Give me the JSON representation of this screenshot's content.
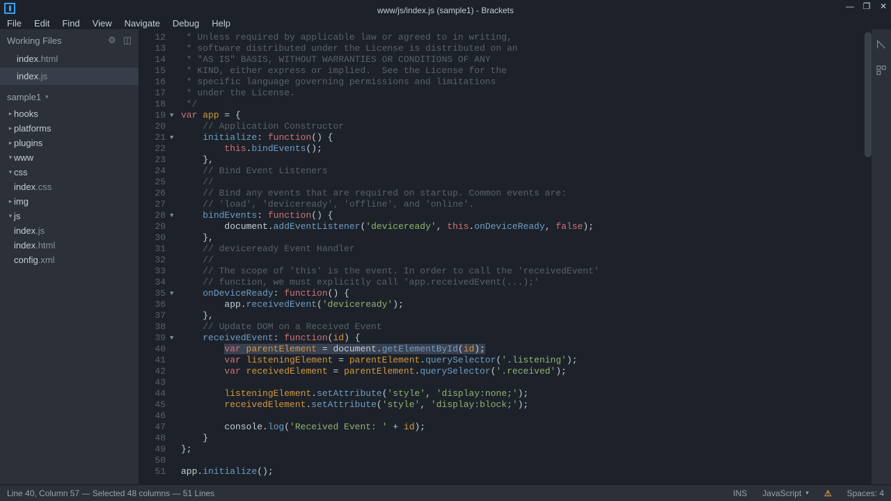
{
  "titlebar": {
    "title": "www/js/index.js (sample1) - Brackets"
  },
  "menu": [
    "File",
    "Edit",
    "Find",
    "View",
    "Navigate",
    "Debug",
    "Help"
  ],
  "workingFiles": {
    "label": "Working Files",
    "items": [
      {
        "name": "index",
        "ext": ".html",
        "active": false
      },
      {
        "name": "index",
        "ext": ".js",
        "active": true
      }
    ]
  },
  "project": {
    "name": "sample1",
    "tree": [
      {
        "depth": 1,
        "caret": "▸",
        "name": "hooks"
      },
      {
        "depth": 1,
        "caret": "▸",
        "name": "platforms"
      },
      {
        "depth": 1,
        "caret": "▸",
        "name": "plugins"
      },
      {
        "depth": 1,
        "caret": "▾",
        "name": "www"
      },
      {
        "depth": 2,
        "caret": "▾",
        "name": "css"
      },
      {
        "depth": 3,
        "caret": "",
        "name": "index",
        "ext": ".css"
      },
      {
        "depth": 2,
        "caret": "▸",
        "name": "img"
      },
      {
        "depth": 2,
        "caret": "▾",
        "name": "js"
      },
      {
        "depth": 3,
        "caret": "",
        "name": "index",
        "ext": ".js"
      },
      {
        "depth": 2,
        "caret": "",
        "name": "index",
        "ext": ".html"
      },
      {
        "depth": 1,
        "caret": "",
        "name": "config",
        "ext": ".xml"
      }
    ]
  },
  "code": {
    "startLine": 12,
    "folds": {
      "19": "▼",
      "21": "▼",
      "28": "▼",
      "35": "▼",
      "39": "▼"
    },
    "lines": [
      [
        {
          "t": " * Unless required by applicable law or agreed to in writing,",
          "c": "cmt"
        }
      ],
      [
        {
          "t": " * software distributed under the License is distributed on an",
          "c": "cmt"
        }
      ],
      [
        {
          "t": " * \"AS IS\" BASIS, WITHOUT WARRANTIES OR CONDITIONS OF ANY",
          "c": "cmt"
        }
      ],
      [
        {
          "t": " * KIND, either express or implied.  See the License for the",
          "c": "cmt"
        }
      ],
      [
        {
          "t": " * specific language governing permissions and limitations",
          "c": "cmt"
        }
      ],
      [
        {
          "t": " * under the License.",
          "c": "cmt"
        }
      ],
      [
        {
          "t": " */",
          "c": "cmt"
        }
      ],
      [
        {
          "t": "var ",
          "c": "key"
        },
        {
          "t": "app",
          "c": "var"
        },
        {
          "t": " = {",
          "c": "punc"
        }
      ],
      [
        {
          "t": "    ",
          "c": "punc"
        },
        {
          "t": "// Application Constructor",
          "c": "cmt"
        }
      ],
      [
        {
          "t": "    ",
          "c": "punc"
        },
        {
          "t": "initialize",
          "c": "prop"
        },
        {
          "t": ": ",
          "c": "punc"
        },
        {
          "t": "function",
          "c": "func"
        },
        {
          "t": "() {",
          "c": "punc"
        }
      ],
      [
        {
          "t": "        ",
          "c": "punc"
        },
        {
          "t": "this",
          "c": "key"
        },
        {
          "t": ".",
          "c": "punc"
        },
        {
          "t": "bindEvents",
          "c": "prop"
        },
        {
          "t": "();",
          "c": "punc"
        }
      ],
      [
        {
          "t": "    },",
          "c": "punc"
        }
      ],
      [
        {
          "t": "    ",
          "c": "punc"
        },
        {
          "t": "// Bind Event Listeners",
          "c": "cmt"
        }
      ],
      [
        {
          "t": "    ",
          "c": "punc"
        },
        {
          "t": "//",
          "c": "cmt"
        }
      ],
      [
        {
          "t": "    ",
          "c": "punc"
        },
        {
          "t": "// Bind any events that are required on startup. Common events are:",
          "c": "cmt"
        }
      ],
      [
        {
          "t": "    ",
          "c": "punc"
        },
        {
          "t": "// 'load', 'deviceready', 'offline', and 'online'.",
          "c": "cmt"
        }
      ],
      [
        {
          "t": "    ",
          "c": "punc"
        },
        {
          "t": "bindEvents",
          "c": "prop"
        },
        {
          "t": ": ",
          "c": "punc"
        },
        {
          "t": "function",
          "c": "func"
        },
        {
          "t": "() {",
          "c": "punc"
        }
      ],
      [
        {
          "t": "        document.",
          "c": "punc"
        },
        {
          "t": "addEventListener",
          "c": "prop"
        },
        {
          "t": "(",
          "c": "punc"
        },
        {
          "t": "'deviceready'",
          "c": "str"
        },
        {
          "t": ", ",
          "c": "punc"
        },
        {
          "t": "this",
          "c": "key"
        },
        {
          "t": ".",
          "c": "punc"
        },
        {
          "t": "onDeviceReady",
          "c": "prop"
        },
        {
          "t": ", ",
          "c": "punc"
        },
        {
          "t": "false",
          "c": "key"
        },
        {
          "t": ");",
          "c": "punc"
        }
      ],
      [
        {
          "t": "    },",
          "c": "punc"
        }
      ],
      [
        {
          "t": "    ",
          "c": "punc"
        },
        {
          "t": "// deviceready Event Handler",
          "c": "cmt"
        }
      ],
      [
        {
          "t": "    ",
          "c": "punc"
        },
        {
          "t": "//",
          "c": "cmt"
        }
      ],
      [
        {
          "t": "    ",
          "c": "punc"
        },
        {
          "t": "// The scope of 'this' is the event. In order to call the 'receivedEvent'",
          "c": "cmt"
        }
      ],
      [
        {
          "t": "    ",
          "c": "punc"
        },
        {
          "t": "// function, we must explicitly call 'app.receivedEvent(...);'",
          "c": "cmt"
        }
      ],
      [
        {
          "t": "    ",
          "c": "punc"
        },
        {
          "t": "onDeviceReady",
          "c": "prop"
        },
        {
          "t": ": ",
          "c": "punc"
        },
        {
          "t": "function",
          "c": "func"
        },
        {
          "t": "() {",
          "c": "punc"
        }
      ],
      [
        {
          "t": "        app.",
          "c": "punc"
        },
        {
          "t": "receivedEvent",
          "c": "prop"
        },
        {
          "t": "(",
          "c": "punc"
        },
        {
          "t": "'deviceready'",
          "c": "str"
        },
        {
          "t": ");",
          "c": "punc"
        }
      ],
      [
        {
          "t": "    },",
          "c": "punc"
        }
      ],
      [
        {
          "t": "    ",
          "c": "punc"
        },
        {
          "t": "// Update DOM on a Received Event",
          "c": "cmt"
        }
      ],
      [
        {
          "t": "    ",
          "c": "punc"
        },
        {
          "t": "receivedEvent",
          "c": "prop"
        },
        {
          "t": ": ",
          "c": "punc"
        },
        {
          "t": "function",
          "c": "func"
        },
        {
          "t": "(",
          "c": "punc"
        },
        {
          "t": "id",
          "c": "var"
        },
        {
          "t": ") {",
          "c": "punc"
        }
      ],
      [
        {
          "t": "        ",
          "c": "punc"
        },
        {
          "t": "var ",
          "c": "key",
          "sel": true
        },
        {
          "t": "parentElement",
          "c": "var",
          "sel": true
        },
        {
          "t": " = document.",
          "c": "punc",
          "sel": true
        },
        {
          "t": "getElementById",
          "c": "prop",
          "sel": true
        },
        {
          "t": "(",
          "c": "punc",
          "sel": true
        },
        {
          "t": "id",
          "c": "var",
          "sel": true
        },
        {
          "t": ");",
          "c": "punc",
          "sel": true
        }
      ],
      [
        {
          "t": "        ",
          "c": "punc"
        },
        {
          "t": "var ",
          "c": "key"
        },
        {
          "t": "listeningElement",
          "c": "var"
        },
        {
          "t": " = ",
          "c": "punc"
        },
        {
          "t": "parentElement",
          "c": "var"
        },
        {
          "t": ".",
          "c": "punc"
        },
        {
          "t": "querySelector",
          "c": "prop"
        },
        {
          "t": "(",
          "c": "punc"
        },
        {
          "t": "'.listening'",
          "c": "str"
        },
        {
          "t": ");",
          "c": "punc"
        }
      ],
      [
        {
          "t": "        ",
          "c": "punc"
        },
        {
          "t": "var ",
          "c": "key"
        },
        {
          "t": "receivedElement",
          "c": "var"
        },
        {
          "t": " = ",
          "c": "punc"
        },
        {
          "t": "parentElement",
          "c": "var"
        },
        {
          "t": ".",
          "c": "punc"
        },
        {
          "t": "querySelector",
          "c": "prop"
        },
        {
          "t": "(",
          "c": "punc"
        },
        {
          "t": "'.received'",
          "c": "str"
        },
        {
          "t": ");",
          "c": "punc"
        }
      ],
      [],
      [
        {
          "t": "        ",
          "c": "punc"
        },
        {
          "t": "listeningElement",
          "c": "var"
        },
        {
          "t": ".",
          "c": "punc"
        },
        {
          "t": "setAttribute",
          "c": "prop"
        },
        {
          "t": "(",
          "c": "punc"
        },
        {
          "t": "'style'",
          "c": "str"
        },
        {
          "t": ", ",
          "c": "punc"
        },
        {
          "t": "'display:none;'",
          "c": "str"
        },
        {
          "t": ");",
          "c": "punc"
        }
      ],
      [
        {
          "t": "        ",
          "c": "punc"
        },
        {
          "t": "receivedElement",
          "c": "var"
        },
        {
          "t": ".",
          "c": "punc"
        },
        {
          "t": "setAttribute",
          "c": "prop"
        },
        {
          "t": "(",
          "c": "punc"
        },
        {
          "t": "'style'",
          "c": "str"
        },
        {
          "t": ", ",
          "c": "punc"
        },
        {
          "t": "'display:block;'",
          "c": "str"
        },
        {
          "t": ");",
          "c": "punc"
        }
      ],
      [],
      [
        {
          "t": "        console.",
          "c": "punc"
        },
        {
          "t": "log",
          "c": "prop"
        },
        {
          "t": "(",
          "c": "punc"
        },
        {
          "t": "'Received Event: '",
          "c": "str"
        },
        {
          "t": " + ",
          "c": "punc"
        },
        {
          "t": "id",
          "c": "var"
        },
        {
          "t": ");",
          "c": "punc"
        }
      ],
      [
        {
          "t": "    }",
          "c": "punc"
        }
      ],
      [
        {
          "t": "};",
          "c": "punc"
        }
      ],
      [],
      [
        {
          "t": "app.",
          "c": "punc"
        },
        {
          "t": "initialize",
          "c": "prop"
        },
        {
          "t": "();",
          "c": "punc"
        }
      ]
    ]
  },
  "status": {
    "left": "Line 40, Column 57 — Selected 48 columns — 51 Lines",
    "ins": "INS",
    "lang": "JavaScript",
    "spaces": "Spaces: 4"
  }
}
